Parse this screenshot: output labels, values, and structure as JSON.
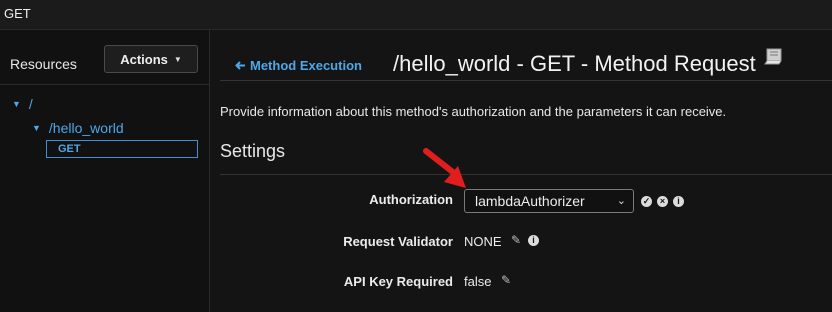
{
  "topbar": {
    "crumb": "GET"
  },
  "sidebar": {
    "title": "Resources",
    "actions_label": "Actions",
    "tree": [
      {
        "label": "/"
      },
      {
        "label": "/hello_world"
      },
      {
        "label": "GET"
      }
    ]
  },
  "header": {
    "back_label": "Method Execution",
    "title": "/hello_world - GET - Method Request"
  },
  "main": {
    "description": "Provide information about this method's authorization and the parameters it can receive.",
    "settings_heading": "Settings",
    "fields": {
      "authorization": {
        "label": "Authorization",
        "value": "lambdaAuthorizer"
      },
      "request_validator": {
        "label": "Request Validator",
        "value": "NONE"
      },
      "api_key_required": {
        "label": "API Key Required",
        "value": "false"
      }
    }
  },
  "colors": {
    "accent": "#4ea7e8",
    "annotation_arrow": "#e01e1e"
  }
}
